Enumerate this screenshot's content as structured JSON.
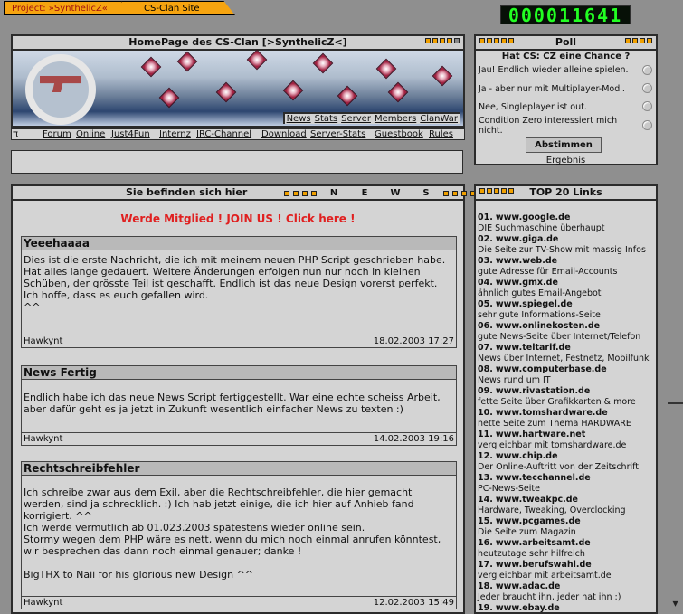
{
  "tabs": [
    {
      "label": "Project: »SynthelicZ«"
    },
    {
      "label": "CS-Clan Site"
    }
  ],
  "counter": "000011641",
  "banner": {
    "title": "HomePage des CS-Clan [>SynthelicZ<]",
    "nav": [
      "News",
      "Stats",
      "Server",
      "Members",
      "ClanWar"
    ]
  },
  "subnav": {
    "pi": "π",
    "items": [
      "Forum",
      "Online",
      "Just4Fun",
      "Internz",
      "IRC-Channel",
      "Download",
      "Server-Stats",
      "Guestbook",
      "Rules"
    ]
  },
  "poll": {
    "title": "Poll",
    "question": "Hat CS: CZ eine Chance ?",
    "options": [
      "Jau! Endlich wieder alleine spielen.",
      "Ja - aber nur mit Multiplayer-Modi.",
      "Nee, Singleplayer ist out.",
      "Condition Zero interessiert mich nicht."
    ],
    "vote": "Abstimmen",
    "result": "Ergebnis"
  },
  "news": {
    "header": "Sie befinden sich hier",
    "letters": [
      "N",
      "E",
      "W",
      "S"
    ],
    "join": "Werde Mitglied ! JOIN US ! Click here !",
    "articles": [
      {
        "title": "Yeeehaaaa",
        "body": "Dies ist die erste Nachricht, die ich mit meinem neuen PHP Script geschrieben habe. Hat alles lange gedauert. Weitere Änderungen erfolgen nun nur noch in kleinen Schüben, der grösste Teil ist geschafft. Endlich ist das neue Design vorerst perfekt. Ich hoffe, dass es euch gefallen wird.\n^^",
        "author": "Hawkynt",
        "date": "18.02.2003 17:27"
      },
      {
        "title": "News Fertig",
        "body": "Endlich habe ich das neue News Script fertiggestellt. War eine echte scheiss Arbeit, aber dafür geht es ja jetzt in Zukunft wesentlich einfacher News zu texten :)",
        "author": "Hawkynt",
        "date": "14.02.2003 19:16"
      },
      {
        "title": "Rechtschreibfehler",
        "body": "Ich schreibe zwar aus dem Exil, aber die Rechtschreibfehler, die hier gemacht werden, sind ja schrecklich. :) Ich hab jetzt einige, die ich hier auf Anhieb fand korrigiert. ^^\nIch werde vermutlich ab 01.023.2003 spätestens wieder online sein.\nStormy wegen dem PHP wäre es nett, wenn du mich noch einmal anrufen könntest, wir besprechen das dann noch einmal genauer; danke !\n\nBigTHX to Naii for his glorious new Design ^^",
        "author": "Hawkynt",
        "date": "12.02.2003 15:49"
      }
    ]
  },
  "top20": {
    "title": "TOP 20 Links",
    "items": [
      {
        "n": "01.",
        "url": "www.google.de",
        "desc": "DIE Suchmaschine überhaupt"
      },
      {
        "n": "02.",
        "url": "www.giga.de",
        "desc": "Die Seite zur TV-Show mit massig Infos"
      },
      {
        "n": "03.",
        "url": "www.web.de",
        "desc": "gute Adresse für Email-Accounts"
      },
      {
        "n": "04.",
        "url": "www.gmx.de",
        "desc": "ähnlich gutes Email-Angebot"
      },
      {
        "n": "05.",
        "url": "www.spiegel.de",
        "desc": "sehr gute Informations-Seite"
      },
      {
        "n": "06.",
        "url": "www.onlinekosten.de",
        "desc": "gute News-Seite über Internet/Telefon"
      },
      {
        "n": "07.",
        "url": "www.teltarif.de",
        "desc": "News über Internet, Festnetz, Mobilfunk"
      },
      {
        "n": "08.",
        "url": "www.computerbase.de",
        "desc": "News rund um IT"
      },
      {
        "n": "09.",
        "url": "www.rivastation.de",
        "desc": "fette Seite über Grafikkarten & more"
      },
      {
        "n": "10.",
        "url": "www.tomshardware.de",
        "desc": "nette Seite zum Thema HARDWARE"
      },
      {
        "n": "11.",
        "url": "www.hartware.net",
        "desc": "vergleichbar mit tomshardware.de"
      },
      {
        "n": "12.",
        "url": "www.chip.de",
        "desc": "Der Online-Auftritt von der Zeitschrift"
      },
      {
        "n": "13.",
        "url": "www.tecchannel.de",
        "desc": "PC-News-Seite"
      },
      {
        "n": "14.",
        "url": "www.tweakpc.de",
        "desc": "Hardware, Tweaking, Overclocking"
      },
      {
        "n": "15.",
        "url": "www.pcgames.de",
        "desc": "Die Seite zum Magazin"
      },
      {
        "n": "16.",
        "url": "www.arbeitsamt.de",
        "desc": "heutzutage sehr hilfreich"
      },
      {
        "n": "17.",
        "url": "www.berufswahl.de",
        "desc": "vergleichbar mit arbeitsamt.de"
      },
      {
        "n": "18.",
        "url": "www.adac.de",
        "desc": "Jeder braucht ihn, jeder hat ihn :)"
      },
      {
        "n": "19.",
        "url": "www.ebay.de",
        "desc": ""
      }
    ]
  }
}
